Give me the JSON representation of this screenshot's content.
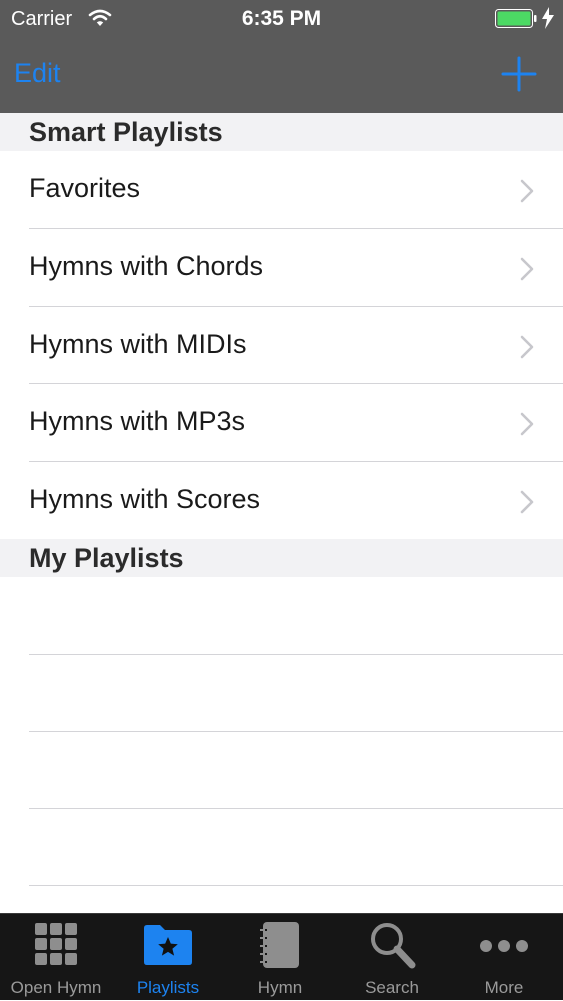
{
  "status_bar": {
    "carrier": "Carrier",
    "time": "6:35 PM"
  },
  "nav": {
    "edit_label": "Edit",
    "add_icon": "plus-icon"
  },
  "sections": [
    {
      "title": "Smart Playlists",
      "items": [
        {
          "label": "Favorites"
        },
        {
          "label": "Hymns with Chords"
        },
        {
          "label": "Hymns with MIDIs"
        },
        {
          "label": "Hymns with MP3s"
        },
        {
          "label": "Hymns with Scores"
        }
      ]
    },
    {
      "title": "My Playlists",
      "items": []
    }
  ],
  "tabs": [
    {
      "label": "Open Hymn",
      "icon": "grid-icon",
      "active": false
    },
    {
      "label": "Playlists",
      "icon": "star-folder-icon",
      "active": true
    },
    {
      "label": "Hymn",
      "icon": "book-icon",
      "active": false
    },
    {
      "label": "Search",
      "icon": "search-icon",
      "active": false
    },
    {
      "label": "More",
      "icon": "more-dots-icon",
      "active": false
    }
  ],
  "colors": {
    "accent": "#1d83f0",
    "nav_bg": "#5a5a5a",
    "tab_bg": "#161616",
    "battery": "#4cd964"
  }
}
